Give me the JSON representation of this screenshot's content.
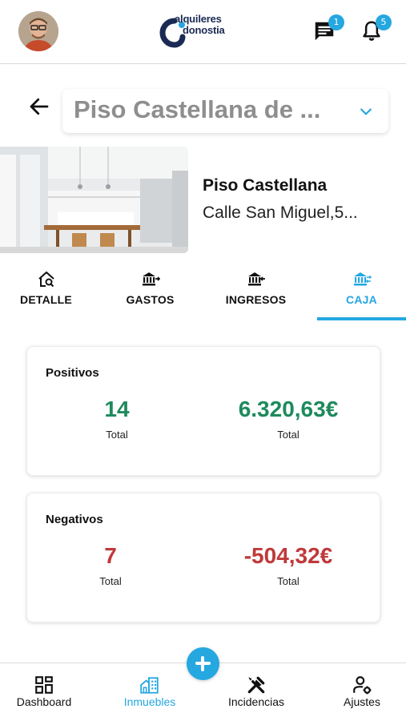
{
  "header": {
    "logo": {
      "line1": "alquileres",
      "line2": "donostia"
    },
    "messages_badge": "1",
    "notifications_badge": "5"
  },
  "property": {
    "selector_value": "Piso Castellana de ...",
    "name": "Piso Castellana",
    "address": "Calle San Miguel,5..."
  },
  "tabs": [
    {
      "label": "DETALLE",
      "icon": "home-search-icon"
    },
    {
      "label": "GASTOS",
      "icon": "bank-out-icon"
    },
    {
      "label": "INGRESOS",
      "icon": "bank-in-icon"
    },
    {
      "label": "CAJA",
      "icon": "bank-transfer-icon",
      "active": true
    }
  ],
  "positivos": {
    "title": "Positivos",
    "count": "14",
    "count_label": "Total",
    "amount": "6.320,63€",
    "amount_label": "Total"
  },
  "negativos": {
    "title": "Negativos",
    "count": "7",
    "count_label": "Total",
    "amount": "-504,32€",
    "amount_label": "Total"
  },
  "nav": [
    {
      "label": "Dashboard",
      "icon": "dashboard-icon"
    },
    {
      "label": "Inmuebles",
      "icon": "buildings-icon",
      "active": true
    },
    {
      "label": "Incidencias",
      "icon": "tools-icon"
    },
    {
      "label": "Ajustes",
      "icon": "user-settings-icon"
    }
  ],
  "colors": {
    "accent": "#25a7e0",
    "positive": "#1d8a5b",
    "negative": "#c0393b"
  }
}
